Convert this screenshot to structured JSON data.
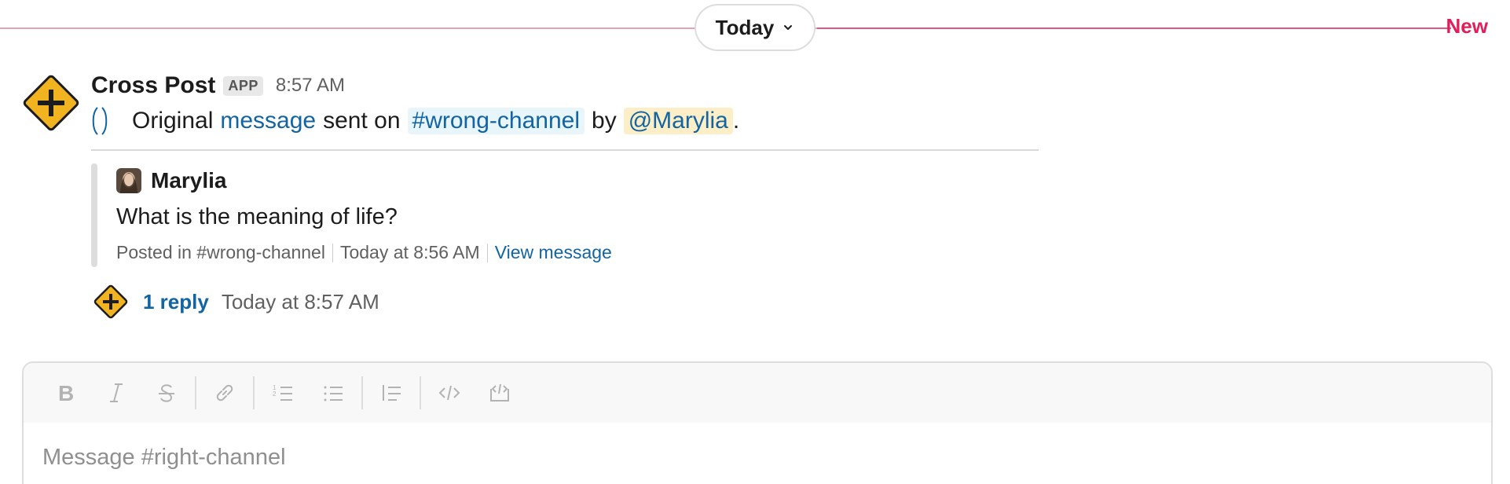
{
  "divider": {
    "date_label": "Today",
    "new_label": "New"
  },
  "message": {
    "sender": "Cross Post",
    "badge": "APP",
    "time": "8:57 AM",
    "text_prefix": "Original",
    "text_link": "message",
    "text_middle": "sent on",
    "channel": "#wrong-channel",
    "text_by": "by",
    "mention": "@Marylia",
    "text_end": "."
  },
  "quote": {
    "author": "Marylia",
    "text": "What is the meaning of life?",
    "posted_in": "Posted in #wrong-channel",
    "posted_time": "Today at 8:56 AM",
    "view_link": "View message"
  },
  "reply": {
    "count_label": "1 reply",
    "time": "Today at 8:57 AM"
  },
  "composer": {
    "placeholder": "Message #right-channel",
    "tools": [
      "bold-icon",
      "italic-icon",
      "strikethrough-icon",
      "link-icon",
      "ordered-list-icon",
      "bulleted-list-icon",
      "blockquote-icon",
      "code-icon",
      "code-block-icon"
    ]
  },
  "colors": {
    "accent_new": "#e01e5a",
    "link": "#1264a3",
    "app_icon_bg": "#f2b321"
  }
}
